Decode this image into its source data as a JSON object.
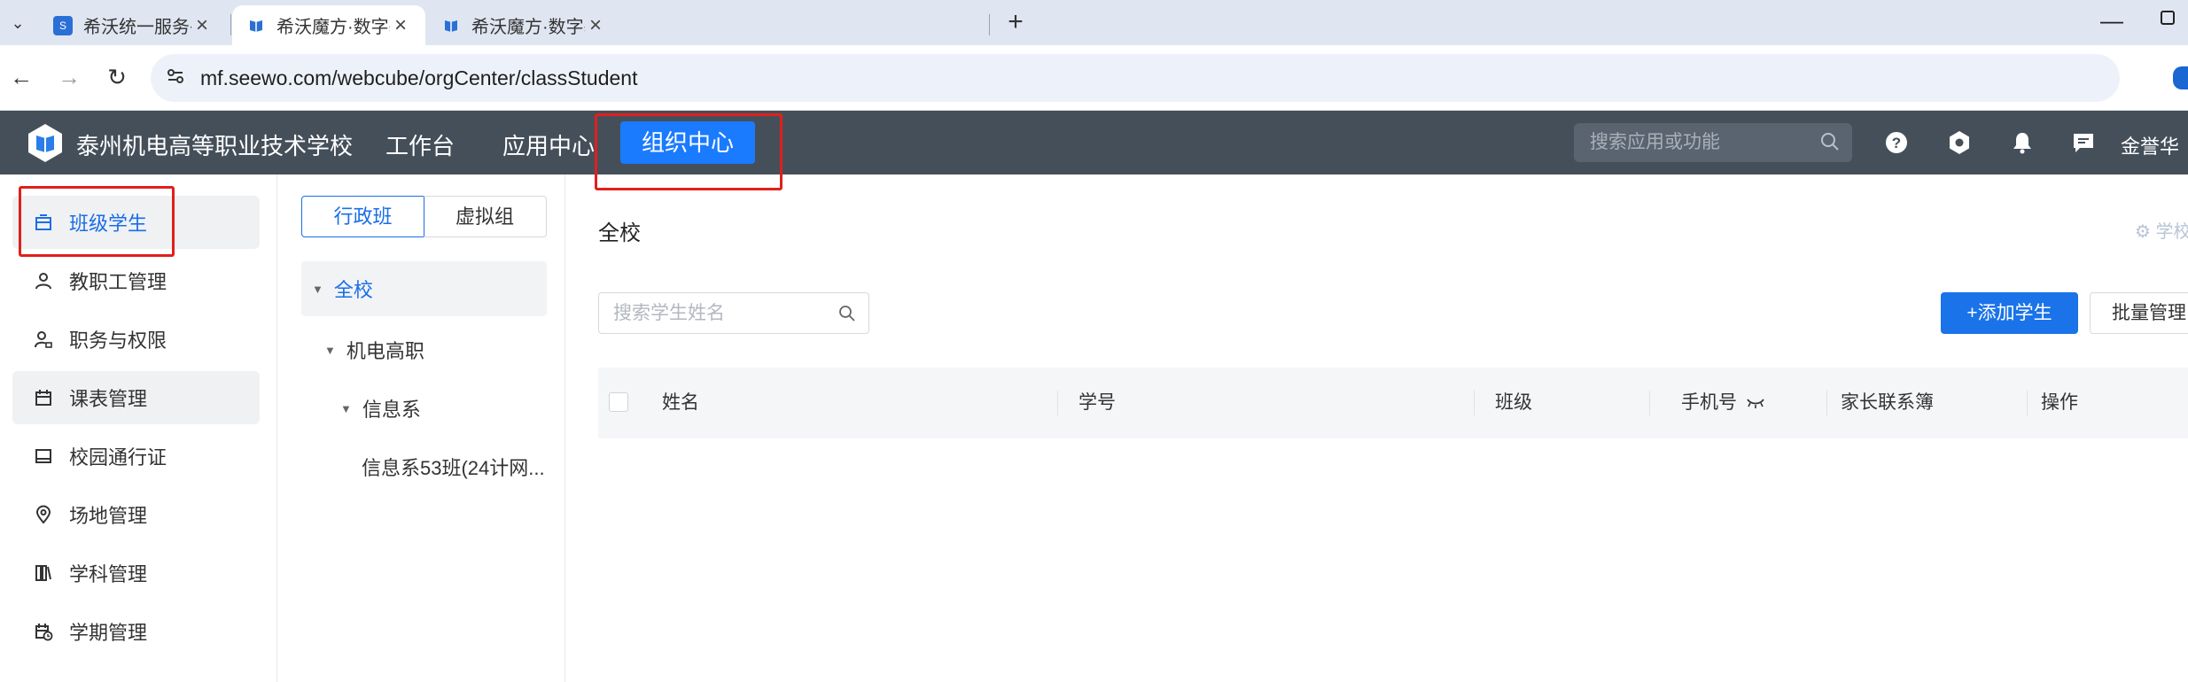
{
  "browser": {
    "tabs": [
      {
        "label": "希沃统一服务平台",
        "active": false
      },
      {
        "label": "希沃魔方·数字基座",
        "active": true
      },
      {
        "label": "希沃魔方·数字基座",
        "active": false
      }
    ],
    "url": "mf.seewo.com/webcube/orgCenter/classStudent"
  },
  "header": {
    "school_name": "泰州机电高等职业技术学校",
    "nav": [
      "工作台",
      "应用中心",
      "组织中心"
    ],
    "active_nav": "组织中心",
    "search_placeholder": "搜索应用或功能",
    "user_name": "金誉华"
  },
  "sidebar": {
    "items": [
      {
        "label": "班级学生",
        "icon": "class-student-icon",
        "active": true
      },
      {
        "label": "教职工管理",
        "icon": "person-icon"
      },
      {
        "label": "职务与权限",
        "icon": "person-lock-icon"
      },
      {
        "label": "课表管理",
        "icon": "calendar-icon"
      },
      {
        "label": "校园通行证",
        "icon": "pass-card-icon"
      },
      {
        "label": "场地管理",
        "icon": "location-pin-icon"
      },
      {
        "label": "学科管理",
        "icon": "books-icon"
      },
      {
        "label": "学期管理",
        "icon": "calendar-clock-icon"
      }
    ]
  },
  "tree": {
    "segments": [
      "行政班",
      "虚拟组"
    ],
    "nodes": [
      "全校",
      "机电高职",
      "信息系",
      "信息系53班(24计网..."
    ]
  },
  "main": {
    "title": "全校",
    "settings_label": "学校",
    "student_search_placeholder": "搜索学生姓名",
    "add_button": "+添加学生",
    "batch_button": "批量管理",
    "columns": [
      "姓名",
      "学号",
      "班级",
      "手机号",
      "家长联系簿",
      "操作"
    ]
  },
  "colors": {
    "app_header_bg": "#454f5a",
    "accent_blue": "#1a7bff",
    "annotation_red": "#e0201c"
  }
}
